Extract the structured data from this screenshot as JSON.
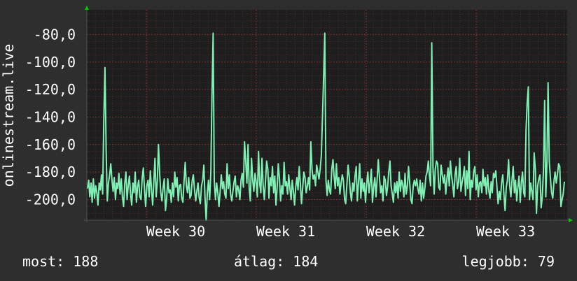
{
  "chart_data": {
    "type": "line",
    "ylabel": "onlinestream.live",
    "yticks": [
      "-80,0",
      "-100,0",
      "-120,0",
      "-140,0",
      "-160,0",
      "-180,0",
      "-200,0"
    ],
    "ytick_values": [
      -80,
      -100,
      -120,
      -140,
      -160,
      -180,
      -200
    ],
    "xticks": [
      "Week 30",
      "Week 31",
      "Week 32",
      "Week 33"
    ],
    "ylim": [
      -215,
      -62
    ],
    "grid": true,
    "colors": {
      "line": "#7ff0b4",
      "plot_bg": "#1e1e1e",
      "grid": "#7a3030",
      "axis_arrow": "#00cc00"
    },
    "series": [
      {
        "values": [
          -192,
          -186,
          -198,
          -188,
          -202,
          -185,
          -199,
          -190,
          -195,
          -204,
          -188,
          -193,
          -182,
          -196,
          -140,
          -104,
          -165,
          -201,
          -188,
          -182,
          -174,
          -186,
          -194,
          -184,
          -200,
          -188,
          -192,
          -181,
          -196,
          -185,
          -198,
          -205,
          -188,
          -180,
          -200,
          -190,
          -183,
          -196,
          -204,
          -188,
          -195,
          -180,
          -202,
          -191,
          -186,
          -198,
          -200,
          -184,
          -177,
          -193,
          -205,
          -190,
          -186,
          -198,
          -179,
          -193,
          -204,
          -187,
          -170,
          -198,
          -186,
          -160,
          -181,
          -195,
          -201,
          -191,
          -185,
          -208,
          -200,
          -185,
          -195,
          -193,
          -202,
          -188,
          -198,
          -180,
          -191,
          -184,
          -201,
          -190,
          -189,
          -199,
          -202,
          -186,
          -173,
          -190,
          -195,
          -184,
          -199,
          -197,
          -186,
          -182,
          -193,
          -201,
          -194,
          -188,
          -199,
          -203,
          -190,
          -186,
          -175,
          -199,
          -215,
          -195,
          -186,
          -200,
          -180,
          -125,
          -79,
          -186,
          -200,
          -188,
          -195,
          -205,
          -194,
          -182,
          -192,
          -187,
          -196,
          -199,
          -174,
          -192,
          -182,
          -196,
          -201,
          -194,
          -187,
          -183,
          -198,
          -190,
          -193,
          -200,
          -186,
          -181,
          -191,
          -158,
          -172,
          -188,
          -160,
          -192,
          -201,
          -170,
          -186,
          -194,
          -181,
          -187,
          -198,
          -165,
          -188,
          -195,
          -170,
          -190,
          -200,
          -187,
          -172,
          -178,
          -199,
          -184,
          -190,
          -176,
          -195,
          -183,
          -204,
          -192,
          -174,
          -185,
          -201,
          -190,
          -196,
          -173,
          -190,
          -187,
          -196,
          -182,
          -192,
          -200,
          -186,
          -194,
          -204,
          -191,
          -184,
          -193,
          -176,
          -189,
          -203,
          -191,
          -180,
          -184,
          -195,
          -190,
          -184,
          -193,
          -158,
          -178,
          -185,
          -182,
          -190,
          -175,
          -180,
          -185,
          -178,
          -168,
          -140,
          -110,
          -79,
          -186,
          -197,
          -186,
          -193,
          -196,
          -178,
          -171,
          -183,
          -192,
          -174,
          -190,
          -184,
          -196,
          -188,
          -182,
          -186,
          -200,
          -203,
          -189,
          -175,
          -183,
          -195,
          -201,
          -188,
          -194,
          -183,
          -176,
          -201,
          -187,
          -174,
          -199,
          -185,
          -194,
          -188,
          -202,
          -189,
          -180,
          -195,
          -188,
          -178,
          -202,
          -191,
          -184,
          -198,
          -185,
          -171,
          -184,
          -195,
          -190,
          -201,
          -183,
          -186,
          -197,
          -191,
          -180,
          -172,
          -190,
          -196,
          -202,
          -188,
          -195,
          -187,
          -199,
          -180,
          -194,
          -186,
          -189,
          -198,
          -181,
          -196,
          -190,
          -176,
          -188,
          -200,
          -203,
          -190,
          -186,
          -190,
          -185,
          -192,
          -196,
          -186,
          -201,
          -188,
          -199,
          -192,
          -183,
          -180,
          -172,
          -183,
          -190,
          -86,
          -176,
          -196,
          -178,
          -172,
          -174,
          -191,
          -193,
          -175,
          -182,
          -188,
          -182,
          -196,
          -185,
          -177,
          -190,
          -172,
          -183,
          -189,
          -198,
          -182,
          -176,
          -192,
          -187,
          -170,
          -194,
          -188,
          -183,
          -176,
          -197,
          -179,
          -192,
          -165,
          -200,
          -186,
          -191,
          -180,
          -176,
          -193,
          -182,
          -198,
          -188,
          -187,
          -195,
          -178,
          -190,
          -184,
          -196,
          -182,
          -193,
          -199,
          -187,
          -195,
          -181,
          -184,
          -179,
          -191,
          -203,
          -194,
          -200,
          -188,
          -182,
          -196,
          -208,
          -191,
          -186,
          -171,
          -190,
          -198,
          -185,
          -176,
          -195,
          -186,
          -201,
          -191,
          -183,
          -202,
          -188,
          -180,
          -195,
          -198,
          -150,
          -130,
          -118,
          -200,
          -188,
          -194,
          -200,
          -166,
          -178,
          -210,
          -190,
          -185,
          -182,
          -206,
          -198,
          -179,
          -128,
          -198,
          -172,
          -115,
          -172,
          -185,
          -195,
          -199,
          -187,
          -180,
          -188,
          -182,
          -174,
          -176,
          -205,
          -200,
          -196,
          -187
        ]
      }
    ]
  },
  "footer": {
    "now": "most: 188",
    "avg": "átlag: 184",
    "best": "legjobb: 79"
  }
}
